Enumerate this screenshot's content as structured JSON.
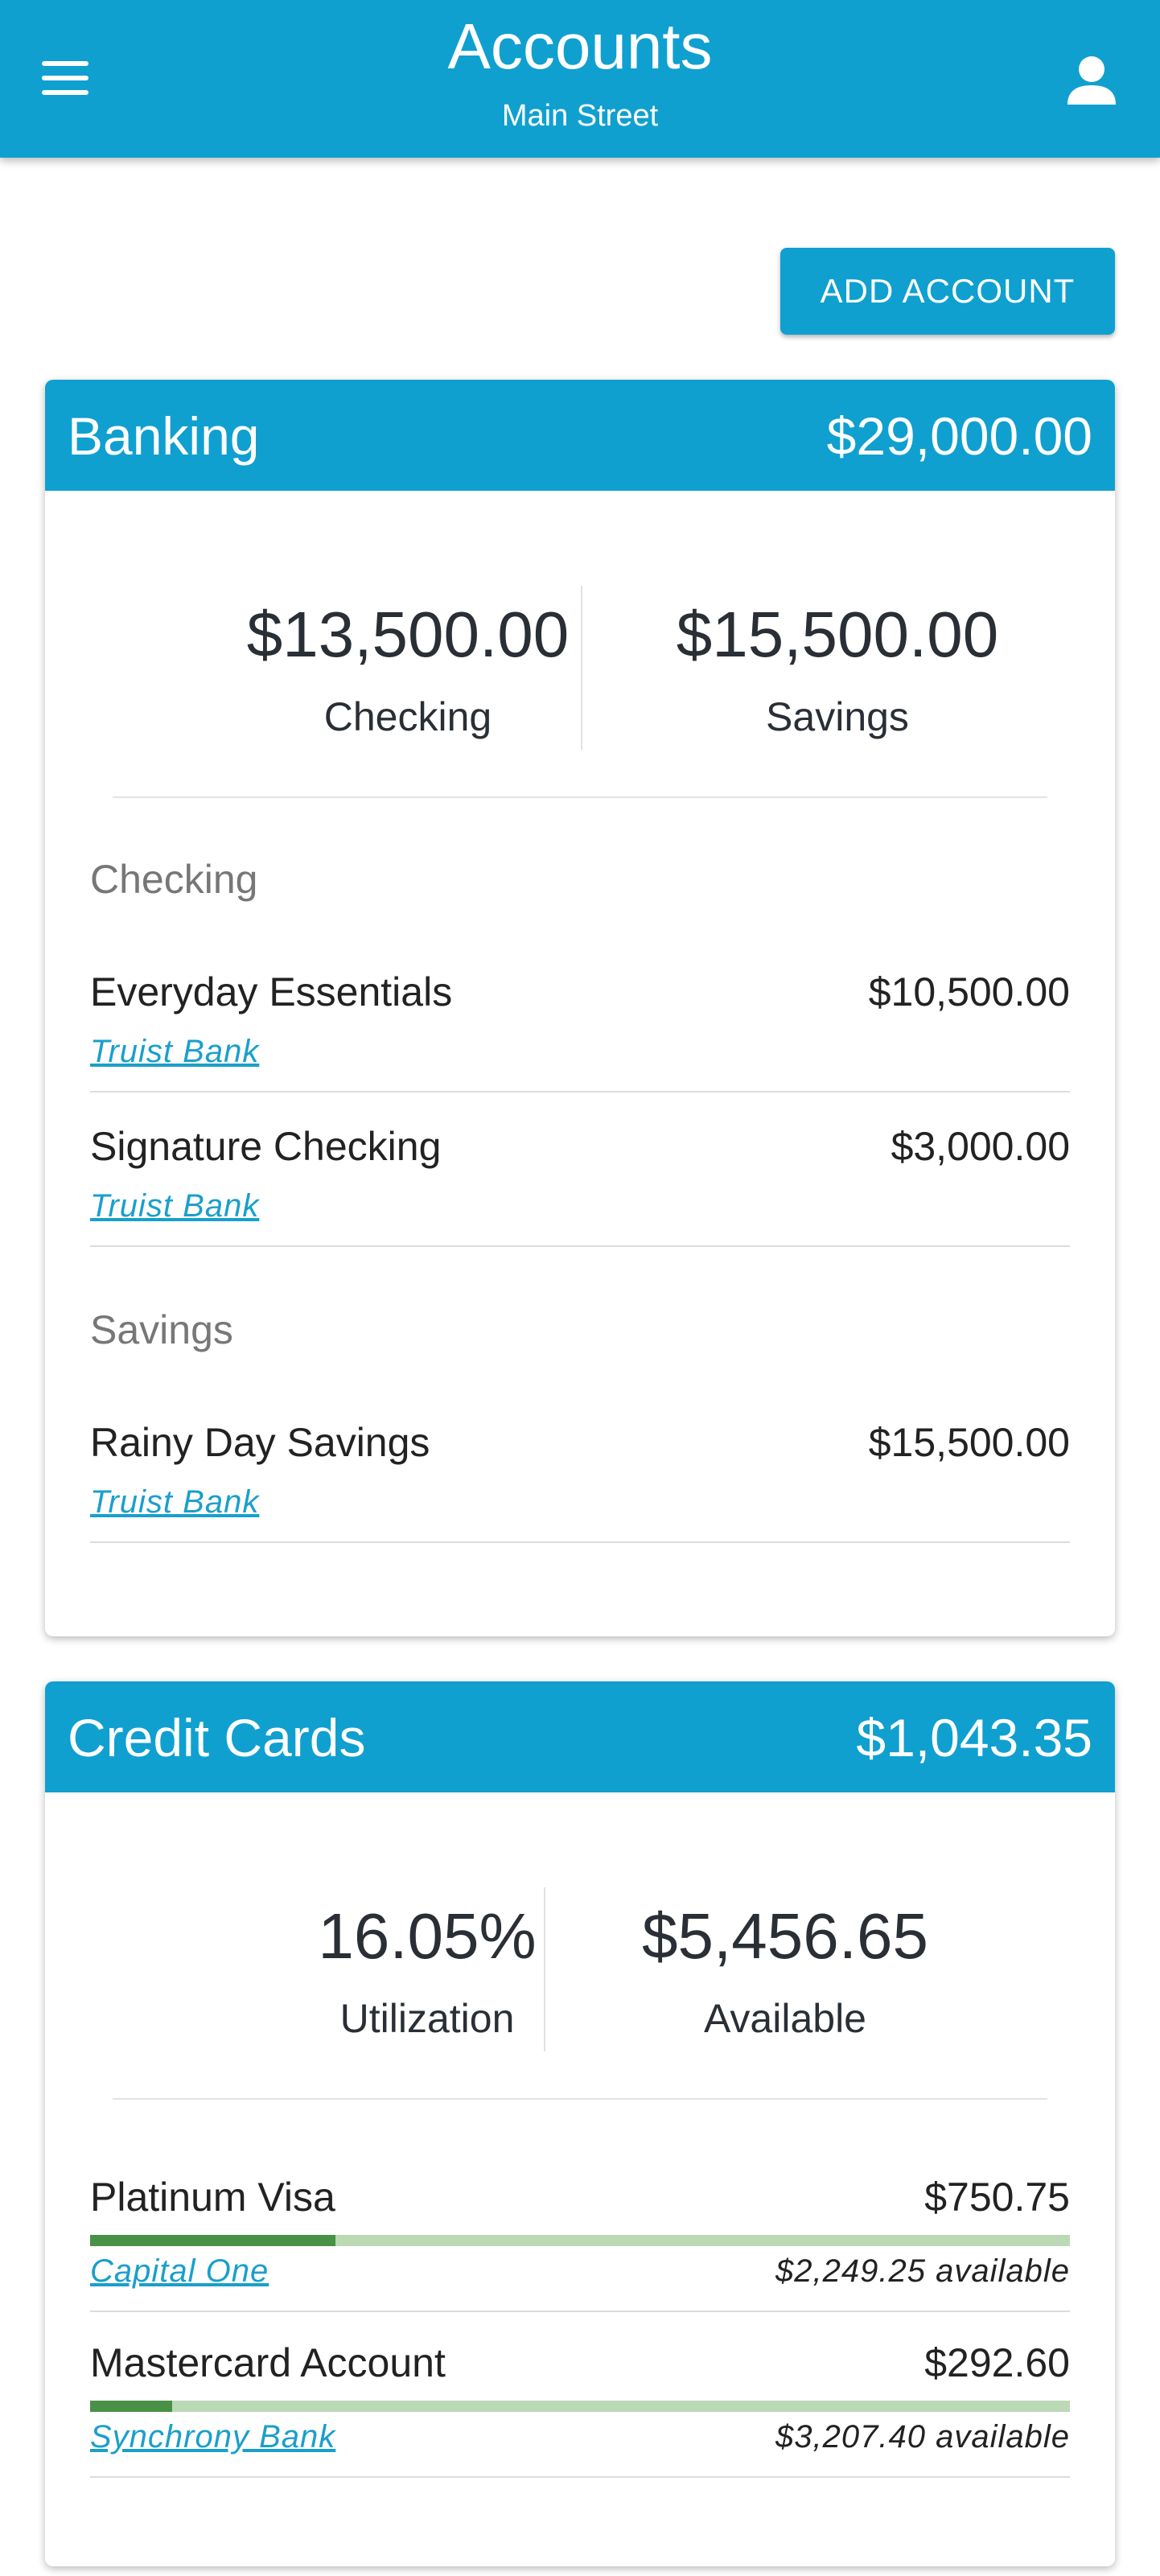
{
  "header": {
    "title": "Accounts",
    "subtitle": "Main Street",
    "menu_icon": "hamburger-menu-icon",
    "user_icon": "user-account-icon",
    "background_color": "#0fa0d0"
  },
  "actions": {
    "add_account_label": "ADD ACCOUNT"
  },
  "banking": {
    "title": "Banking",
    "total": "$29,000.00",
    "summary": [
      {
        "value": "$13,500.00",
        "label": "Checking"
      },
      {
        "value": "$15,500.00",
        "label": "Savings"
      }
    ],
    "groups": [
      {
        "label": "Checking",
        "accounts": [
          {
            "name": "Everyday Essentials",
            "amount": "$10,500.00",
            "bank": "Truist Bank"
          },
          {
            "name": "Signature Checking",
            "amount": "$3,000.00",
            "bank": "Truist Bank"
          }
        ]
      },
      {
        "label": "Savings",
        "accounts": [
          {
            "name": "Rainy Day Savings",
            "amount": "$15,500.00",
            "bank": "Truist Bank"
          }
        ]
      }
    ]
  },
  "credit_cards": {
    "title": "Credit Cards",
    "total": "$1,043.35",
    "summary": [
      {
        "value": "16.05%",
        "label": "Utilization"
      },
      {
        "value": "$5,456.65",
        "label": "Available"
      }
    ],
    "accounts": [
      {
        "name": "Platinum Visa",
        "amount": "$750.75",
        "bank": "Capital One",
        "available": "$2,249.25 available",
        "utilization": 0.2502
      },
      {
        "name": "Mastercard Account",
        "amount": "$292.60",
        "bank": "Synchrony Bank",
        "available": "$3,207.40 available",
        "utilization": 0.0836
      }
    ],
    "bar_fill_color": "#4a9148",
    "bar_track_color": "#bcd9b6"
  }
}
